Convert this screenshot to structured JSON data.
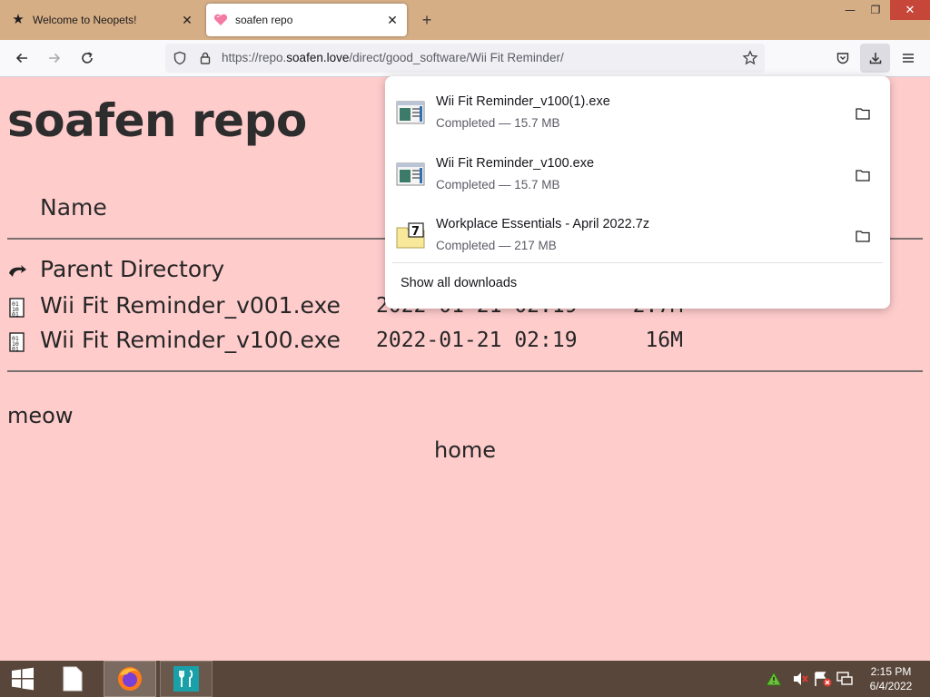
{
  "browser": {
    "tabs": [
      {
        "title": "Welcome to Neopets!",
        "favicon": "star-icon",
        "active": false
      },
      {
        "title": "soafen repo",
        "favicon": "heart-icon",
        "active": true
      }
    ],
    "new_tab_symbol": "+",
    "window_controls": {
      "minimize": "—",
      "maximize": "❐",
      "close": "✕"
    },
    "url": {
      "prefix": "https://repo.",
      "host": "soafen.love",
      "path": "/direct/good_software/Wii Fit Reminder/"
    }
  },
  "page": {
    "title": "soafen repo",
    "column_header": "Name",
    "rows": [
      {
        "icon": "back-arrow-icon",
        "name": "Parent Directory",
        "date": "",
        "size": ""
      },
      {
        "icon": "binary-file-icon",
        "name": "Wii Fit Reminder_v001.exe",
        "date": "2022-01-21 02:19",
        "size": "2.7M"
      },
      {
        "icon": "binary-file-icon",
        "name": "Wii Fit Reminder_v100.exe",
        "date": "2022-01-21 02:19",
        "size": "16M"
      }
    ],
    "footer_text": "meow",
    "home_link": "home"
  },
  "downloads_panel": {
    "items": [
      {
        "name": "Wii Fit Reminder_v100(1).exe",
        "status": "Completed — 15.7 MB",
        "icon": "exe-file-icon"
      },
      {
        "name": "Wii Fit Reminder_v100.exe",
        "status": "Completed — 15.7 MB",
        "icon": "exe-file-icon"
      },
      {
        "name": "Workplace Essentials - April 2022.7z",
        "status": "Completed — 217 MB",
        "icon": "7z-archive-icon"
      }
    ],
    "show_all_label": "Show all downloads"
  },
  "taskbar": {
    "clock_time": "2:15 PM",
    "clock_date": "6/4/2022"
  },
  "colors": {
    "page_background": "#ffcccc",
    "tab_strip": "#d6ae86",
    "taskbar": "#59463a"
  }
}
